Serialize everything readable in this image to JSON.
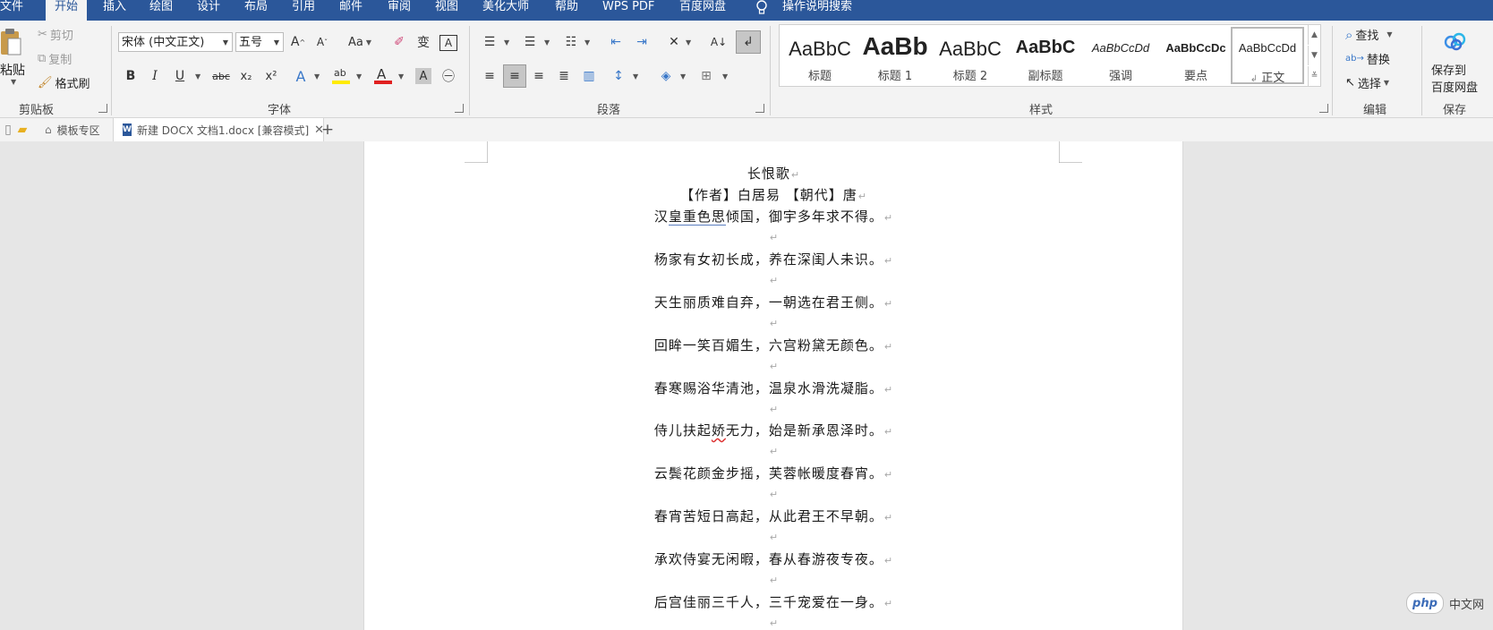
{
  "menu": {
    "items": [
      "文件",
      "开始",
      "插入",
      "绘图",
      "设计",
      "布局",
      "引用",
      "邮件",
      "审阅",
      "视图",
      "美化大师",
      "帮助",
      "WPS PDF",
      "百度网盘"
    ],
    "active": "开始",
    "search_label": "操作说明搜索"
  },
  "ribbon": {
    "clipboard": {
      "paste": "粘贴",
      "cut": "剪切",
      "copy": "复制",
      "format_painter": "格式刷",
      "label": "剪贴板"
    },
    "font": {
      "font_name": "宋体 (中文正文)",
      "font_size": "五号",
      "grow": "A",
      "shrink": "A",
      "change_case": "Aa",
      "phonetic": "变",
      "border_char": "A",
      "bold": "B",
      "italic": "I",
      "underline": "U",
      "strike": "abc",
      "subscript": "x₂",
      "superscript": "x²",
      "font_color": "A",
      "shade": "A",
      "label": "字体"
    },
    "paragraph": {
      "label": "段落"
    },
    "styles": {
      "label": "样式",
      "tiles": [
        {
          "sample": "AaBbC",
          "name": "标题"
        },
        {
          "sample": "AaBb",
          "name": "标题 1"
        },
        {
          "sample": "AaBbC",
          "name": "标题 2"
        },
        {
          "sample": "AaBbC",
          "name": "副标题"
        },
        {
          "sample": "AaBbCcDd",
          "name": "强调"
        },
        {
          "sample": "AaBbCcDc",
          "name": "要点"
        },
        {
          "sample": "AaBbCcDd",
          "name": "正文"
        }
      ]
    },
    "editing": {
      "find": "查找",
      "replace": "替换",
      "select": "选择",
      "label": "编辑"
    },
    "save": {
      "save_line1": "保存到",
      "save_line2": "百度网盘",
      "label": "保存"
    }
  },
  "tabs": {
    "template_tab": "模板专区",
    "doc_tab": "新建 DOCX 文档1.docx [兼容模式]",
    "add": "+"
  },
  "document": {
    "title": "长恨歌",
    "author_line": "【作者】白居易 【朝代】唐",
    "first_line": {
      "pre": "汉",
      "underlined": "皇重色思",
      "post": "倾国，御宇多年求不得。"
    },
    "sixth_line": {
      "pre": "侍儿扶起",
      "underlined": "娇",
      "post": "无力，始是新承恩泽时。"
    },
    "lines": [
      "杨家有女初长成，养在深闺人未识。",
      "天生丽质难自弃，一朝选在君王侧。",
      "回眸一笑百媚生，六宫粉黛无颜色。",
      "春寒赐浴华清池，温泉水滑洗凝脂。",
      "云鬓花颜金步摇，芙蓉帐暖度春宵。",
      "春宵苦短日高起，从此君王不早朝。",
      "承欢侍宴无闲暇，春从春游夜专夜。",
      "后宫佳丽三千人，三千宠爱在一身。"
    ]
  },
  "watermark": {
    "logo": "php",
    "text": "中文网"
  },
  "colors": {
    "menu_bar": "#2b579a",
    "ribbon": "#f3f3f3",
    "doc_background": "#e6e6e6",
    "font_color_bar": "#e02020",
    "highlight_bar": "#ffeb00"
  }
}
